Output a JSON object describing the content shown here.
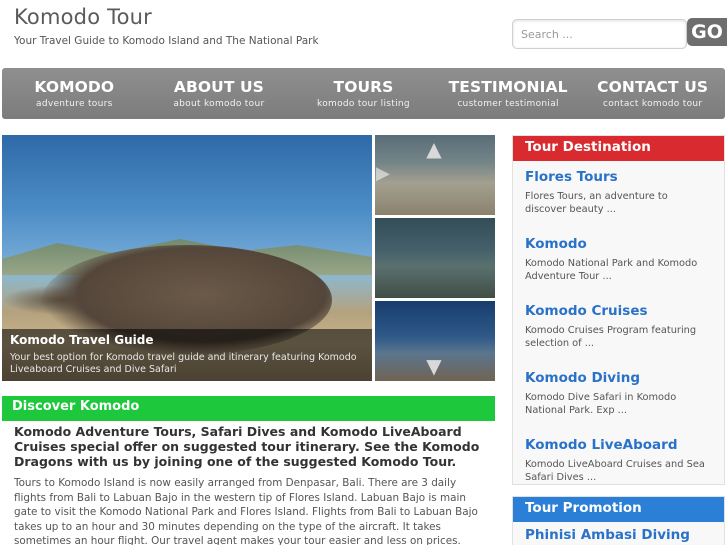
{
  "header": {
    "site_title": "Komodo Tour",
    "tagline": "Your Travel Guide to Komodo Island and The National Park",
    "search_placeholder": "Search ...",
    "search_button": "GO"
  },
  "nav": {
    "items": [
      {
        "label": "KOMODO",
        "sub": "adventure tours"
      },
      {
        "label": "ABOUT US",
        "sub": "about komodo tour"
      },
      {
        "label": "TOURS",
        "sub": "komodo tour listing"
      },
      {
        "label": "TESTIMONIAL",
        "sub": "customer testimonial"
      },
      {
        "label": "CONTACT US",
        "sub": "contact komodo tour"
      }
    ]
  },
  "slider": {
    "caption_title": "Komodo Travel Guide",
    "caption_text": "Your best option for Komodo travel guide and itinerary featuring Komodo Liveaboard Cruises and Dive Safari",
    "arrow_up": "▲",
    "arrow_down": "▼",
    "arrow_right": "▶"
  },
  "discover": {
    "bar_title": "Discover Komodo",
    "heading": "Komodo Adventure Tours, Safari Dives and Komodo LiveAboard Cruises special offer on suggested tour itinerary. See the Komodo Dragons with us by joining one of the suggested Komodo Tour.",
    "body": "Tours to Komodo Island is now easily arranged from Denpasar, Bali. There are 3  daily flights from Bali to Labuan Bajo in the western tip of Flores Island. Labuan Bajo is main gate to visit the Komodo National Park and Flores Island. Flights from Bali to Labuan Bajo takes up to an hour and 30 minutes depending on the type of the aircraft. It takes sometimes an hour flight. Our travel agent makes your tour easier and less on prices. Tailore made package tour can be arranged for couples or group."
  },
  "sidebar": {
    "destination_title": "Tour Destination",
    "destinations": [
      {
        "title": "Flores Tours",
        "desc": "Flores Tours, an adventure to discover beauty ..."
      },
      {
        "title": "Komodo",
        "desc": "Komodo National Park and Komodo Adventure Tour ..."
      },
      {
        "title": "Komodo Cruises",
        "desc": "Komodo Cruises Program featuring selection of ..."
      },
      {
        "title": "Komodo Diving",
        "desc": "Komodo Dive Safari in Komodo National Park. Exp ..."
      },
      {
        "title": "Komodo LiveAboard",
        "desc": "Komodo LiveAboard Cruises and Sea Safari Dives ..."
      }
    ],
    "promotion_title": "Tour Promotion",
    "promotion_item": "Phinisi Ambasi Diving Cruise"
  },
  "colors": {
    "nav_bg": "#858585",
    "discover_green": "#1ec83c",
    "destination_red": "#d92a30",
    "promotion_blue": "#2b7fd6",
    "link_blue": "#2a72c8"
  }
}
